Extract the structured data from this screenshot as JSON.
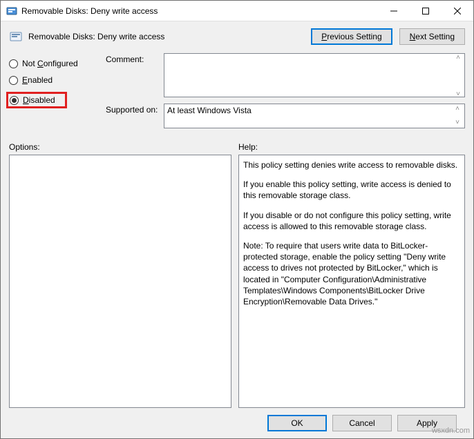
{
  "window": {
    "title": "Removable Disks: Deny write access"
  },
  "header": {
    "title": "Removable Disks: Deny write access"
  },
  "nav": {
    "prev": "revious Setting",
    "prev_u": "P",
    "next": "ext Setting",
    "next_u": "N"
  },
  "radios": {
    "not_configured": "Not ",
    "not_configured_u": "C",
    "not_configured2": "onfigured",
    "enabled_u": "E",
    "enabled": "nabled",
    "disabled_u": "D",
    "disabled": "isabled"
  },
  "labels": {
    "comment": "Comment:",
    "supported": "Supported on:",
    "options": "Options:",
    "help": "Help:"
  },
  "supported": "At least Windows Vista",
  "help": {
    "p1": "This policy setting denies write access to removable disks.",
    "p2": "If you enable this policy setting, write access is denied to this removable storage class.",
    "p3": "If you disable or do not configure this policy setting, write access is allowed to this removable storage class.",
    "p4": "Note: To require that users write data to BitLocker-protected storage, enable the policy setting \"Deny write access to drives not protected by BitLocker,\" which is located in \"Computer Configuration\\Administrative Templates\\Windows Components\\BitLocker Drive Encryption\\Removable Data Drives.\""
  },
  "footer": {
    "ok": "OK",
    "cancel": "Cancel",
    "apply": "Apply"
  },
  "watermark": "wsxdn.com"
}
